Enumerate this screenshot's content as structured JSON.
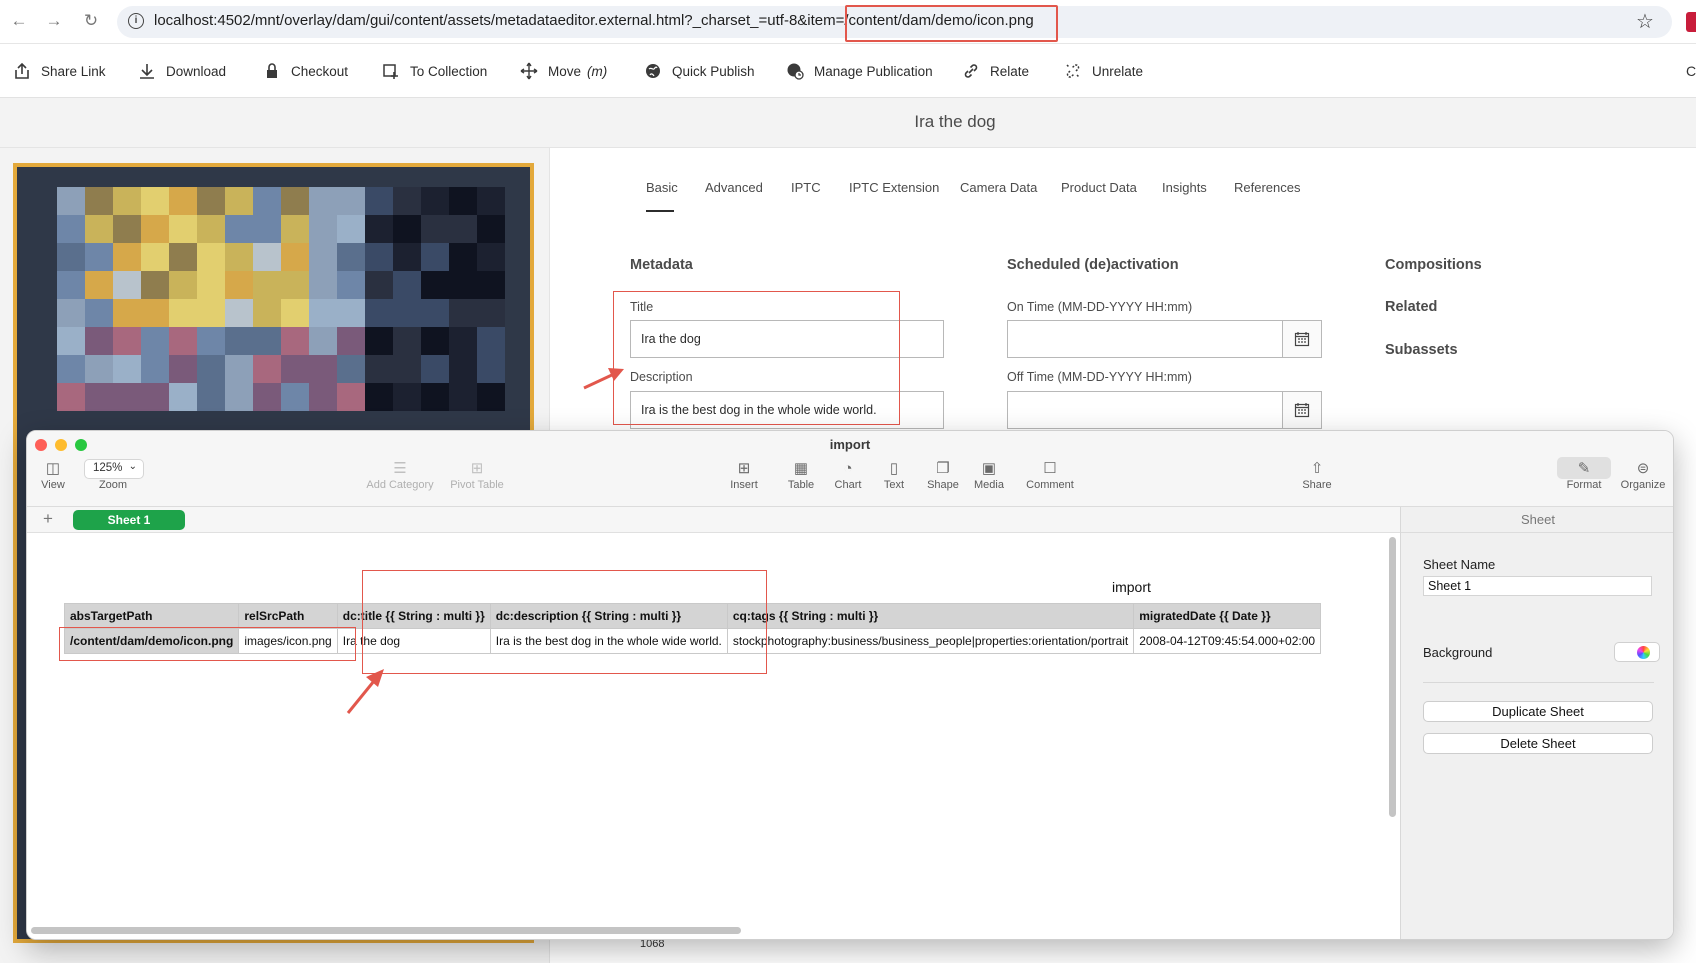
{
  "browser": {
    "url": "localhost:4502/mnt/overlay/dam/gui/content/assets/metadataeditor.external.html?_charset_=utf-8&item=/content/dam/demo/icon.png"
  },
  "toolbar": {
    "items": [
      {
        "label": "Share Link",
        "icon": "share-icon"
      },
      {
        "label": "Download",
        "icon": "download-icon"
      },
      {
        "label": "Checkout",
        "icon": "lock-icon"
      },
      {
        "label": "To Collection",
        "icon": "collection-icon"
      },
      {
        "label": "Move",
        "sub": "(m)",
        "icon": "move-icon"
      },
      {
        "label": "Quick Publish",
        "icon": "globe-icon"
      },
      {
        "label": "Manage Publication",
        "icon": "globe-clock-icon"
      },
      {
        "label": "Relate",
        "icon": "link-icon"
      },
      {
        "label": "Unrelate",
        "icon": "unlink-icon"
      }
    ],
    "overflow": "C"
  },
  "asset": {
    "title": "Ira the dog"
  },
  "tabs": [
    "Basic",
    "Advanced",
    "IPTC",
    "IPTC Extension",
    "Camera Data",
    "Product Data",
    "Insights",
    "References"
  ],
  "form": {
    "metadata_heading": "Metadata",
    "title_label": "Title",
    "title_value": "Ira the dog",
    "description_label": "Description",
    "description_value": "Ira is the best dog in the whole wide world.",
    "schedule_heading": "Scheduled (de)activation",
    "on_time_label": "On Time (MM-DD-YYYY HH:mm)",
    "off_time_label": "Off Time (MM-DD-YYYY HH:mm)",
    "side_links": [
      "Compositions",
      "Related",
      "Subassets"
    ],
    "bottom_value": "1068"
  },
  "numbers": {
    "window_title": "import",
    "toolbar_left": [
      {
        "label": "View",
        "icon": "sidebar-icon"
      },
      {
        "label": "Zoom",
        "value": "125%"
      },
      {
        "label": "Add Category",
        "icon": "list-icon"
      },
      {
        "label": "Pivot Table",
        "icon": "pivot-icon"
      }
    ],
    "toolbar_mid": [
      {
        "label": "Insert",
        "icon": "insert-icon"
      },
      {
        "label": "Table",
        "icon": "table-icon"
      },
      {
        "label": "Chart",
        "icon": "chart-icon"
      },
      {
        "label": "Text",
        "icon": "text-icon"
      },
      {
        "label": "Shape",
        "icon": "shape-icon"
      },
      {
        "label": "Media",
        "icon": "media-icon"
      },
      {
        "label": "Comment",
        "icon": "comment-icon"
      },
      {
        "label": "Share",
        "icon": "share-icon"
      }
    ],
    "toolbar_right": [
      {
        "label": "Format",
        "icon": "format-icon"
      },
      {
        "label": "Organize",
        "icon": "organize-icon"
      }
    ],
    "sheet_tab": "Sheet 1",
    "table_title": "import",
    "headers": [
      "absTargetPath",
      "relSrcPath",
      "dc:title {{ String : multi }}",
      "dc:description {{ String : multi }}",
      "cq:tags {{ String : multi }}",
      "migratedDate {{ Date }}"
    ],
    "rows": [
      [
        "/content/dam/demo/icon.png",
        "images/icon.png",
        "Ira the dog",
        "Ira is the best dog in the whole wide world.",
        "stockphotography:business/business_people|properties:orientation/portrait",
        "2008-04-12T09:45:54.000+02:00"
      ]
    ],
    "inspector": {
      "header": "Sheet",
      "sheet_name_label": "Sheet Name",
      "sheet_name_value": "Sheet 1",
      "background_label": "Background",
      "duplicate_label": "Duplicate Sheet",
      "delete_label": "Delete Sheet"
    }
  },
  "colors": {
    "annotation_red": "#e2574c",
    "sheet_tab_green": "#1ea34a",
    "preview_border": "#e3a93b"
  }
}
